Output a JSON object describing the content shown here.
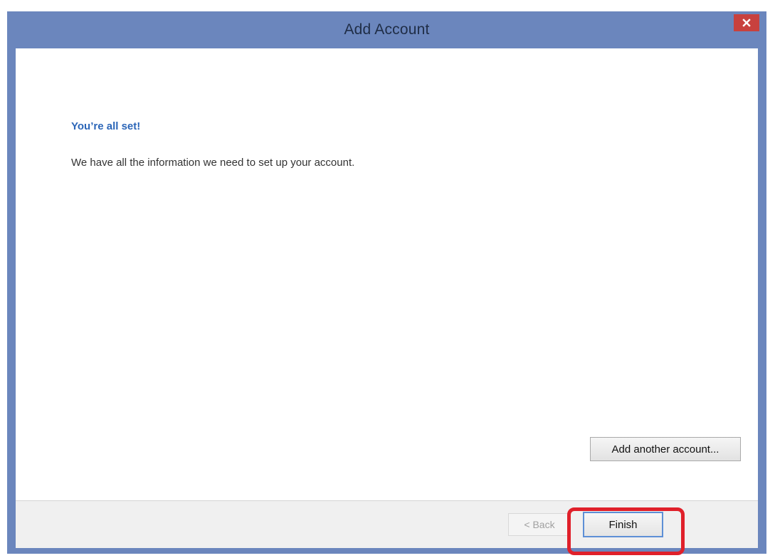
{
  "window": {
    "title": "Add Account",
    "close_label": "×"
  },
  "content": {
    "heading": "You’re all set!",
    "message": "We have all the information we need to set up your account.",
    "add_another_label": "Add another account..."
  },
  "footer": {
    "back_label": "< Back",
    "finish_label": "Finish"
  },
  "colors": {
    "titlebar": "#6b86bd",
    "heading_blue": "#2c66b8",
    "close_red": "#c8413e",
    "highlight_red": "#e0202a"
  },
  "icons": {
    "close": "close-icon"
  }
}
